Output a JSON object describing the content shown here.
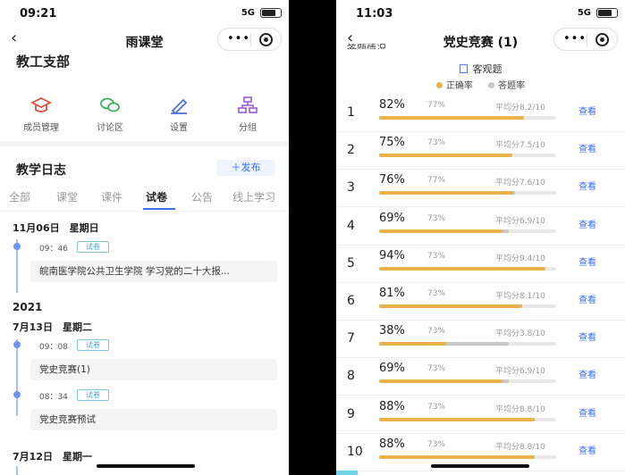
{
  "left": {
    "status": {
      "time": "09:21",
      "signal": "5G"
    },
    "nav": {
      "title": "雨课堂"
    },
    "group_name": "教工支部",
    "tools": [
      {
        "label": "成员管理",
        "icon": "graduation-cap-icon"
      },
      {
        "label": "讨论区",
        "icon": "chat-bubbles-icon"
      },
      {
        "label": "设置",
        "icon": "pencil-icon"
      },
      {
        "label": "分组",
        "icon": "org-chart-icon"
      }
    ],
    "section_title": "教学日志",
    "publish_label": "＋发布",
    "tabs": [
      "全部",
      "课堂",
      "课件",
      "试卷",
      "公告",
      "线上学习"
    ],
    "active_tab": "试卷",
    "timeline": {
      "date1": "11月06日　星期日",
      "item1": {
        "time": "09：46",
        "tag": "试卷",
        "title": "皖南医学院公共卫生学院 学习党的二十大报..."
      },
      "year": "2021",
      "date2": "7月13日　星期二",
      "item2": {
        "time": "09：08",
        "tag": "试卷",
        "title": "党史竞赛(1)"
      },
      "item3": {
        "time": "08：34",
        "tag": "试卷",
        "title": "党史竞赛预试"
      },
      "date3": "7月12日　星期一"
    }
  },
  "right": {
    "status": {
      "time": "11:03",
      "signal": "5G"
    },
    "nav": {
      "title": "党史竞赛 (1)"
    },
    "cut_heading": "答题情况",
    "objective_label": "客观题",
    "legend": {
      "accuracy": "正确率",
      "answer_rate": "答题率"
    },
    "colors": {
      "accuracy": "#eab34a",
      "answer_rate": "#c8c8c8",
      "link": "#3a6cf4"
    },
    "view_label": "查看",
    "rows": [
      {
        "num": "1",
        "acc": "82%",
        "ans": "77%",
        "avg": "平均分8.2/10",
        "acc_v": 82,
        "ans_v": 77
      },
      {
        "num": "2",
        "acc": "75%",
        "ans": "73%",
        "avg": "平均分7.5/10",
        "acc_v": 75,
        "ans_v": 73
      },
      {
        "num": "3",
        "acc": "76%",
        "ans": "77%",
        "avg": "平均分7.6/10",
        "acc_v": 76,
        "ans_v": 77
      },
      {
        "num": "4",
        "acc": "69%",
        "ans": "73%",
        "avg": "平均分6.9/10",
        "acc_v": 69,
        "ans_v": 73
      },
      {
        "num": "5",
        "acc": "94%",
        "ans": "73%",
        "avg": "平均分9.4/10",
        "acc_v": 94,
        "ans_v": 73
      },
      {
        "num": "6",
        "acc": "81%",
        "ans": "73%",
        "avg": "平均分8.1/10",
        "acc_v": 81,
        "ans_v": 73
      },
      {
        "num": "7",
        "acc": "38%",
        "ans": "73%",
        "avg": "平均分3.8/10",
        "acc_v": 38,
        "ans_v": 73
      },
      {
        "num": "8",
        "acc": "69%",
        "ans": "73%",
        "avg": "平均分6.9/10",
        "acc_v": 69,
        "ans_v": 73
      },
      {
        "num": "9",
        "acc": "88%",
        "ans": "73%",
        "avg": "平均分8.8/10",
        "acc_v": 88,
        "ans_v": 73
      },
      {
        "num": "10",
        "acc": "88%",
        "ans": "73%",
        "avg": "平均分8.8/10",
        "acc_v": 88,
        "ans_v": 73
      }
    ]
  }
}
